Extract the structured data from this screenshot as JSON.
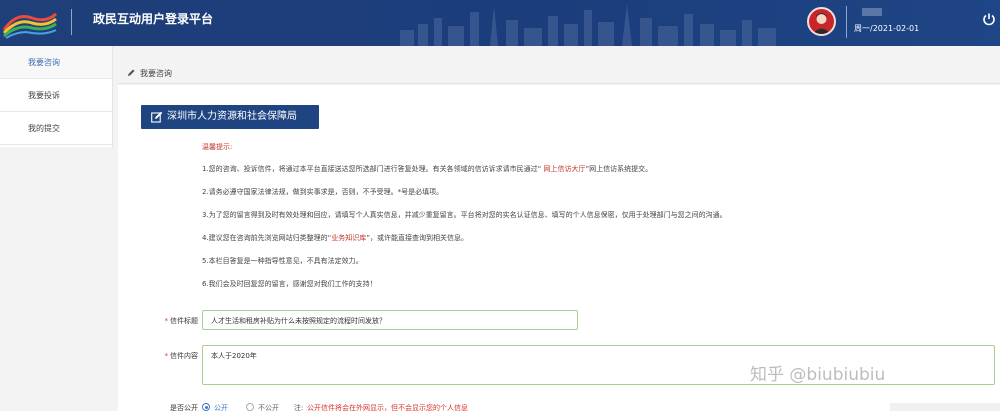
{
  "header": {
    "title": "政民互动用户登录平台",
    "date": "周一/2021-02-01",
    "colors": {
      "bar": "#1f3f7a",
      "avatar": "#c8262b"
    }
  },
  "sidebar": {
    "items": [
      {
        "label": "我要咨询",
        "active": true
      },
      {
        "label": "我要投诉",
        "active": false
      },
      {
        "label": "我的提交",
        "active": false
      }
    ]
  },
  "breadcrumb": {
    "label": "我要咨询"
  },
  "main": {
    "department_button": "深圳市人力资源和社会保障局",
    "tips_title": "温馨提示:",
    "tips": {
      "t1_a": "1.您的咨询、投诉信件，将通过本平台直接送达您所选部门进行答复处理。有关各领域的信访诉求请市民通过“",
      "t1_red": " 网上信访大厅",
      "t1_b": "”网上信访系统提交。",
      "t2": "2.请务必遵守国家法律法规，做到实事求是，否则，不予受理。*号是必填项。",
      "t3": "3.为了您的留言得到及时有效处理和回应，请填写个人真实信息，并减少重复留言。平台将对您的实名认证信息、填写的个人信息保密，仅用于处理部门与您之间的沟通。",
      "t4_a": "4.建议您在咨询前先浏览网站归类整理的“",
      "t4_red": "业务知识库",
      "t4_b": "”，或许能直接查询到相关信息。",
      "t5": "5.本栏目答复是一种指导性意见，不具有法定效力。",
      "t6": "6.我们会及时回复您的留言，感谢您对我们工作的支持！"
    },
    "form": {
      "subject_label": "信件标题",
      "subject_value": "人才生活和租房补贴为什么未按照规定的流程时间发放？",
      "content_label": "信件内容",
      "content_value": "本人于2020年",
      "public_label": "是否公开",
      "public_yes": "公开",
      "public_no": "不公开",
      "public_note_prefix": "注:",
      "public_note": "公开信件将会在外网显示，但不会显示您的个人信息"
    }
  },
  "watermark": "知乎 @biubiubiu"
}
